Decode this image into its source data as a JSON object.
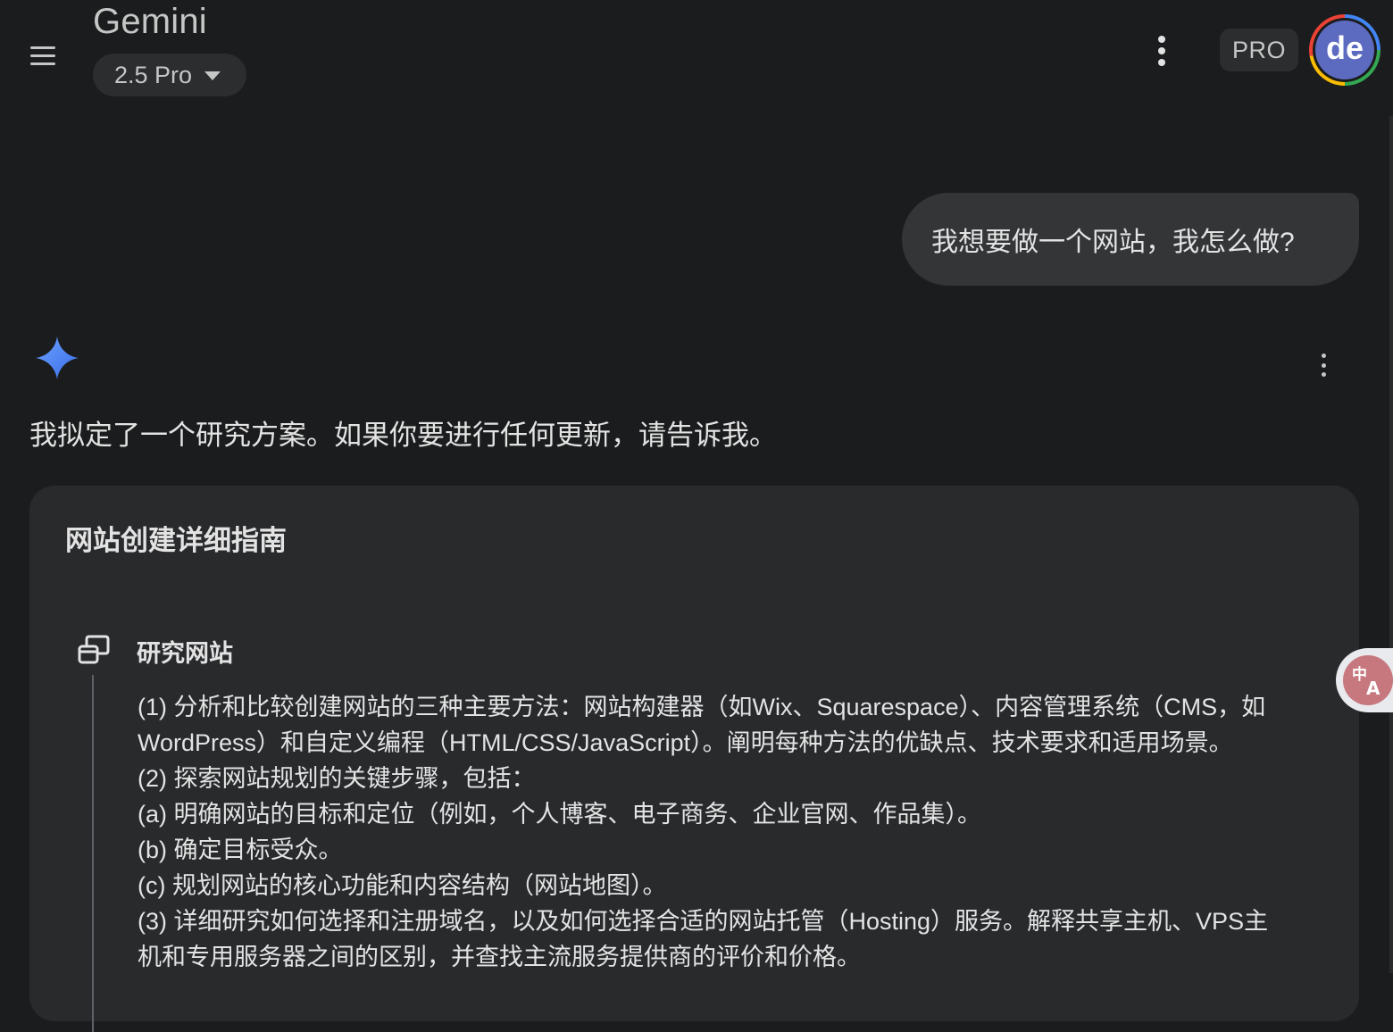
{
  "header": {
    "app_title": "Gemini",
    "model_label": "2.5 Pro",
    "badge": "PRO",
    "avatar_initials": "de"
  },
  "conversation": {
    "user_message": "我想要做一个网站，我怎么做?",
    "response_intro": "我拟定了一个研究方案。如果你要进行任何更新，请告诉我。"
  },
  "plan": {
    "title": "网站创建详细指南",
    "step": {
      "title": "研究网站",
      "lines": [
        "(1) 分析和比较创建网站的三种主要方法：网站构建器（如Wix、Squarespace）、内容管理系统（CMS，如",
        "WordPress）和自定义编程（HTML/CSS/JavaScript）。阐明每种方法的优缺点、技术要求和适用场景。",
        "(2) 探索网站规划的关键步骤，包括：",
        "(a) 明确网站的目标和定位（例如，个人博客、电子商务、企业官网、作品集）。",
        "(b) 确定目标受众。",
        "(c) 规划网站的核心功能和内容结构（网站地图）。",
        "(3) 详细研究如何选择和注册域名，以及如何选择合适的网站托管（Hosting）服务。解释共享主机、VPS主",
        "机和专用服务器之间的区别，并查找主流服务提供商的评价和价格。"
      ]
    }
  },
  "icons": {
    "menu": "hamburger-menu-icon",
    "more": "more-vert-icon",
    "gemini": "gemini-spark-icon",
    "step": "research-step-icon",
    "translate": "translate-icon"
  },
  "colors": {
    "background": "#1b1c1d",
    "card": "#282a2c",
    "bubble": "#333537",
    "spark_blue": "#4285f4"
  }
}
